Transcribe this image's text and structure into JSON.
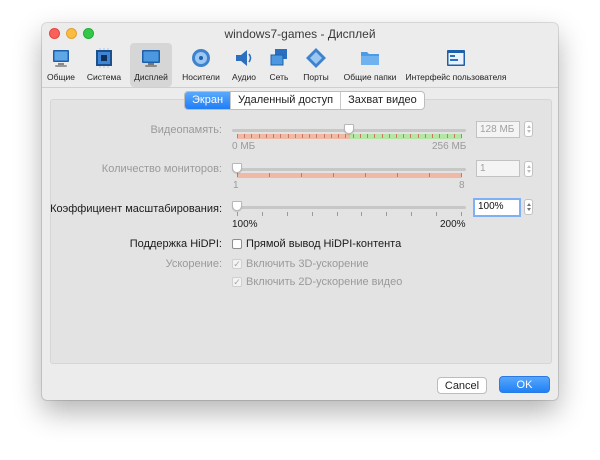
{
  "window": {
    "title": "windows7-games - Дисплей"
  },
  "toolbar": {
    "items": [
      {
        "label": "Общие",
        "icon": "general-monitor-icon"
      },
      {
        "label": "Система",
        "icon": "system-chip-icon"
      },
      {
        "label": "Дисплей",
        "icon": "display-monitor-icon",
        "selected": true
      },
      {
        "label": "Носители",
        "icon": "storage-disk-icon"
      },
      {
        "label": "Аудио",
        "icon": "audio-speaker-icon"
      },
      {
        "label": "Сеть",
        "icon": "network-icon"
      },
      {
        "label": "Порты",
        "icon": "ports-icon"
      },
      {
        "label": "Общие папки",
        "icon": "shared-folder-icon"
      },
      {
        "label": "Интерфейс пользователя",
        "icon": "user-interface-icon"
      }
    ]
  },
  "tabs": [
    {
      "label": "Экран",
      "active": true
    },
    {
      "label": "Удаленный доступ",
      "active": false
    },
    {
      "label": "Захват видео",
      "active": false
    }
  ],
  "screen": {
    "video_memory": {
      "label": "Видеопамять:",
      "min_label": "0 МБ",
      "max_label": "256 МБ",
      "value": "128 МБ",
      "fraction": 0.5,
      "enabled": false
    },
    "monitors": {
      "label": "Количество мониторов:",
      "min_label": "1",
      "max_label": "8",
      "value": "1",
      "fraction": 0.0,
      "enabled": false
    },
    "scale": {
      "label": "Коэффициент масштабирования:",
      "min_label": "100%",
      "max_label": "200%",
      "value": "100%",
      "fraction": 0.0,
      "enabled": true
    },
    "hidpi": {
      "label": "Поддержка HiDPI:",
      "checkbox_label": "Прямой вывод HiDPI-контента",
      "checked": false
    },
    "acceleration": {
      "label": "Ускорение:",
      "options": [
        {
          "label": "Включить 3D-ускорение",
          "checked": true,
          "enabled": false
        },
        {
          "label": "Включить 2D-ускорение видео",
          "checked": true,
          "enabled": false
        }
      ]
    }
  },
  "buttons": {
    "cancel": "Cancel",
    "ok": "OK"
  },
  "colors": {
    "accent": "#2a84f7",
    "band_red": "#f0b9a5",
    "band_green": "#b6e6a6"
  }
}
